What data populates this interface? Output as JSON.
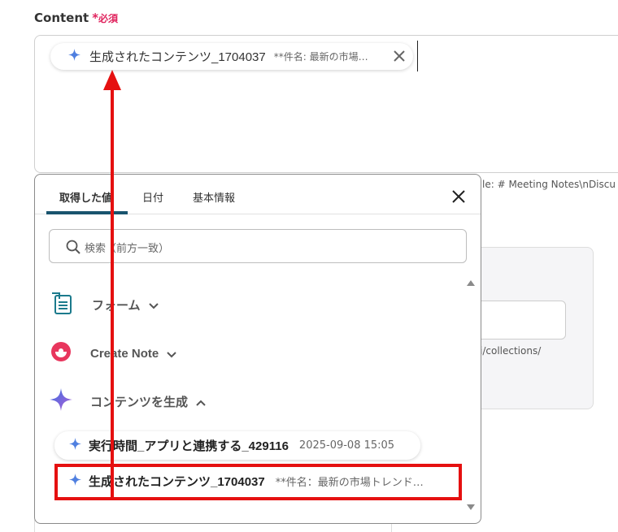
{
  "field": {
    "label": "Content",
    "required_star": "*",
    "required_text": "必須"
  },
  "content_chip": {
    "title": "生成されたコンテンツ_1704037",
    "subtitle": "**件名: 最新の市場…",
    "icon": "sparkle-icon",
    "remove_icon": "close-icon"
  },
  "background": {
    "hint_text": "le: # Meeting Notes\\nDiscu",
    "url_text": "i/collections/"
  },
  "dropdown": {
    "tabs": [
      {
        "label": "取得した値",
        "active": true
      },
      {
        "label": "日付",
        "active": false
      },
      {
        "label": "基本情報",
        "active": false
      }
    ],
    "close_icon": "close-icon",
    "search": {
      "placeholder": "検索（前方一致）",
      "icon": "search-icon"
    },
    "groups": [
      {
        "label": "フォーム",
        "icon": "form-icon",
        "expanded": false
      },
      {
        "label": "Create Note",
        "icon": "create-note-icon",
        "expanded": false
      },
      {
        "label": "コンテンツを生成",
        "icon": "sparkle-icon",
        "expanded": true
      }
    ],
    "items": [
      {
        "title": "実行時間_アプリと連携する_429116",
        "subtitle": "2025-09-08 15:05",
        "icon": "sparkle-icon"
      },
      {
        "title": "生成されたコンテンツ_1704037",
        "subtitle": "**件名：最新の市場トレンド…",
        "icon": "sparkle-icon",
        "highlighted": true
      }
    ]
  },
  "colors": {
    "accent_tab": "#19546e",
    "required": "#e0245e",
    "annotation": "#e51010"
  }
}
